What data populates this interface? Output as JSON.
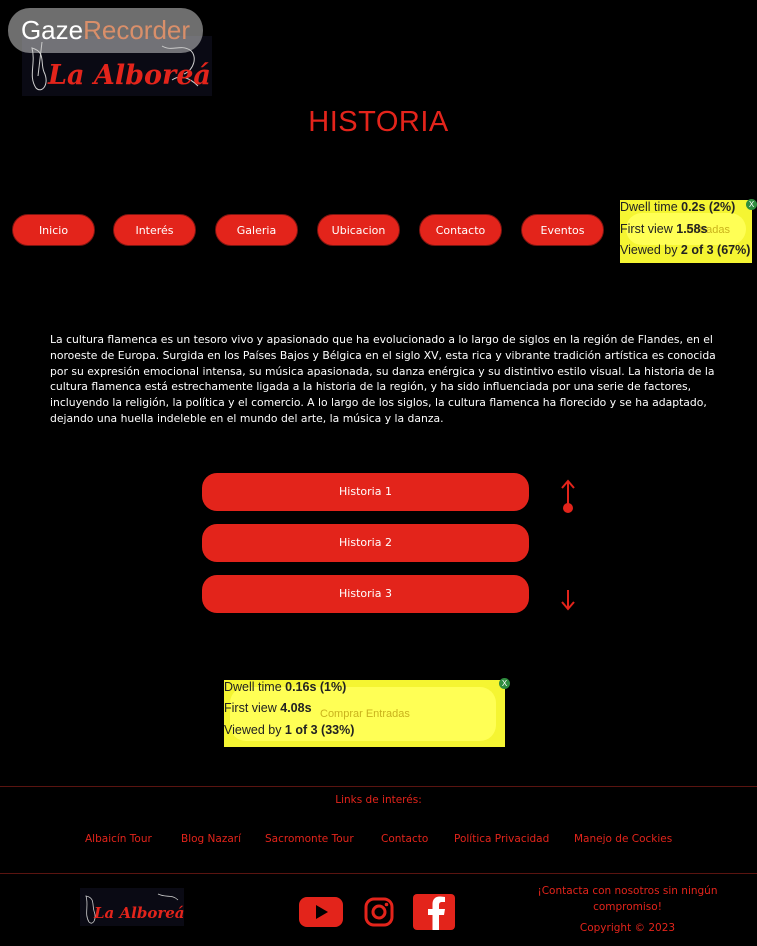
{
  "watermark": {
    "part1": "Gaze",
    "part2": "Recorder"
  },
  "logo": {
    "text": "La Alboreá"
  },
  "page": {
    "title": "HISTORIA"
  },
  "nav": {
    "items": [
      "Inicio",
      "Interés",
      "Galeria",
      "Ubicacion",
      "Contacto",
      "Eventos"
    ],
    "hidden_label": "Entradas"
  },
  "heat_top": {
    "dwell_label": "Dwell time ",
    "dwell_value": "0.2s (2%)",
    "first_label": "First view ",
    "first_value": "1.58s",
    "viewed_label": "Viewed by ",
    "viewed_value": "2 of 3 (67%)",
    "close": "X"
  },
  "intro": {
    "text": "La cultura flamenca es un tesoro vivo y apasionado que ha evolucionado a lo largo de siglos en la región de Flandes, en el noroeste de Europa. Surgida en los Países Bajos y Bélgica en el siglo XV, esta rica y vibrante tradición artística es conocida por su expresión emocional intensa, su música apasionada, su danza enérgica y su distintivo estilo visual. La historia de la cultura flamenca está estrechamente ligada a la historia de la región, y ha sido influenciada por una serie de factores, incluyendo la religión, la política y el comercio. A lo largo de los siglos, la cultura flamenca ha florecido y se ha adaptado, dejando una huella indeleble en el mundo del arte, la música y la danza."
  },
  "history": {
    "items": [
      "Historia 1",
      "Historia 2",
      "Historia 3"
    ]
  },
  "heat_bottom": {
    "dwell_label": "Dwell time ",
    "dwell_value": "0.16s (1%)",
    "first_label": "First view ",
    "first_value": "4.08s",
    "viewed_label": "Viewed by ",
    "viewed_value": "1 of 3 (33%)",
    "button_label": "Comprar Entradas",
    "close": "X"
  },
  "footer": {
    "links_title": "Links de interés:",
    "links": [
      "Albaicín Tour",
      "Blog Nazarí",
      "Sacromonte Tour",
      "Contacto",
      "Política Privacidad",
      "Manejo de Cockies"
    ],
    "contact_cta": "¡Contacta con nosotros sin ningún compromiso!",
    "copyright": "Copyright © 2023"
  },
  "colors": {
    "accent": "#e3241b",
    "heat": "#f5f532",
    "background": "#000000"
  },
  "icons": [
    "youtube-icon",
    "instagram-icon",
    "facebook-icon",
    "arrow-up-icon",
    "arrow-down-icon"
  ]
}
